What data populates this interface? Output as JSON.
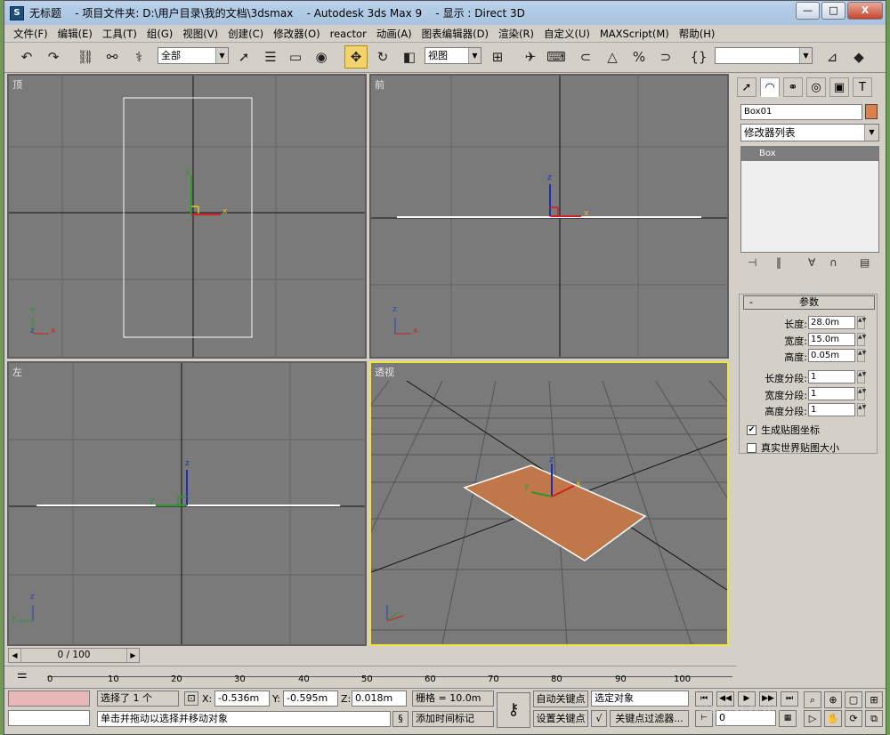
{
  "window": {
    "title": "无标题    - 项目文件夹: D:\\用户目录\\我的文档\\3dsmax    - Autodesk 3ds Max 9    - 显示 : Direct 3D",
    "minimize": "—",
    "maximize": "□",
    "close": "X"
  },
  "menu": [
    "文件(F)",
    "编辑(E)",
    "工具(T)",
    "组(G)",
    "视图(V)",
    "创建(C)",
    "修改器(O)",
    "reactor",
    "动画(A)",
    "图表编辑器(D)",
    "渲染(R)",
    "自定义(U)",
    "MAXScript(M)",
    "帮助(H)"
  ],
  "toolbar": {
    "selection_filter": "全部",
    "ref_coord": "视图",
    "named_selection": ""
  },
  "viewports": {
    "top": "顶",
    "front": "前",
    "left": "左",
    "perspective": "透视"
  },
  "axes": {
    "x": "x",
    "y": "y",
    "z": "z"
  },
  "command_panel": {
    "object_name": "Box01",
    "object_color": "#d9824c",
    "modifier_list": "修改器列表",
    "stack_item": "Box",
    "rollout_title": "参数",
    "minus": "-",
    "params": [
      {
        "label": "长度:",
        "value": "28.0m"
      },
      {
        "label": "宽度:",
        "value": "15.0m"
      },
      {
        "label": "高度:",
        "value": "0.05m"
      },
      {
        "label": "长度分段:",
        "value": "1"
      },
      {
        "label": "宽度分段:",
        "value": "1"
      },
      {
        "label": "高度分段:",
        "value": "1"
      }
    ],
    "gen_map": "生成贴图坐标",
    "real_world": "真实世界贴图大小",
    "gen_map_checked": "✔"
  },
  "timeline": {
    "frame": "0 / 100",
    "ticks": [
      "0",
      "10",
      "20",
      "30",
      "40",
      "50",
      "60",
      "70",
      "80",
      "90",
      "100"
    ]
  },
  "status": {
    "selected": "选择了 1 个",
    "x_label": "X:",
    "x": "-0.536m",
    "y_label": "Y:",
    "y": "-0.595m",
    "z_label": "Z:",
    "z": "0.018m",
    "grid": "栅格 = 10.0m",
    "auto_key": "自动关键点",
    "set_key": "设置关键点",
    "selected_obj": "选定对象",
    "key_filters": "关键点过滤器...",
    "add_tag": "添加时间标记",
    "prompt": "单击并拖动以选择并移动对象",
    "frame_field": "0"
  },
  "watermark": "jingyan.baidu.com",
  "colors": {
    "viewport_bg": "#7a7a7a",
    "active_border": "#f2e33a",
    "box_fill": "#c0784a",
    "move_active": "#f3d36b"
  }
}
